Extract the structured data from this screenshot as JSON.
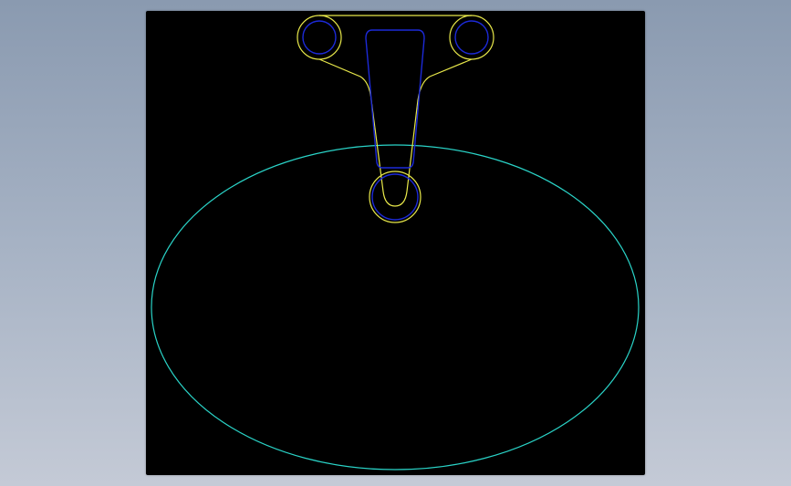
{
  "canvas": {
    "background": "#000000",
    "app_background_top": "#8a9ab0",
    "app_background_bottom": "#c4cad6"
  },
  "colors": {
    "bowl_outline": "#2ad4c8",
    "faucet_outline": "#e8e84a",
    "inner_detail": "#1c2ad8"
  },
  "drawing": {
    "type": "cad-2d-sink-plan",
    "elements": [
      "basin-ellipse",
      "faucet-outline",
      "left-handle-knob",
      "right-handle-knob",
      "spout-body",
      "drain-circle"
    ]
  }
}
